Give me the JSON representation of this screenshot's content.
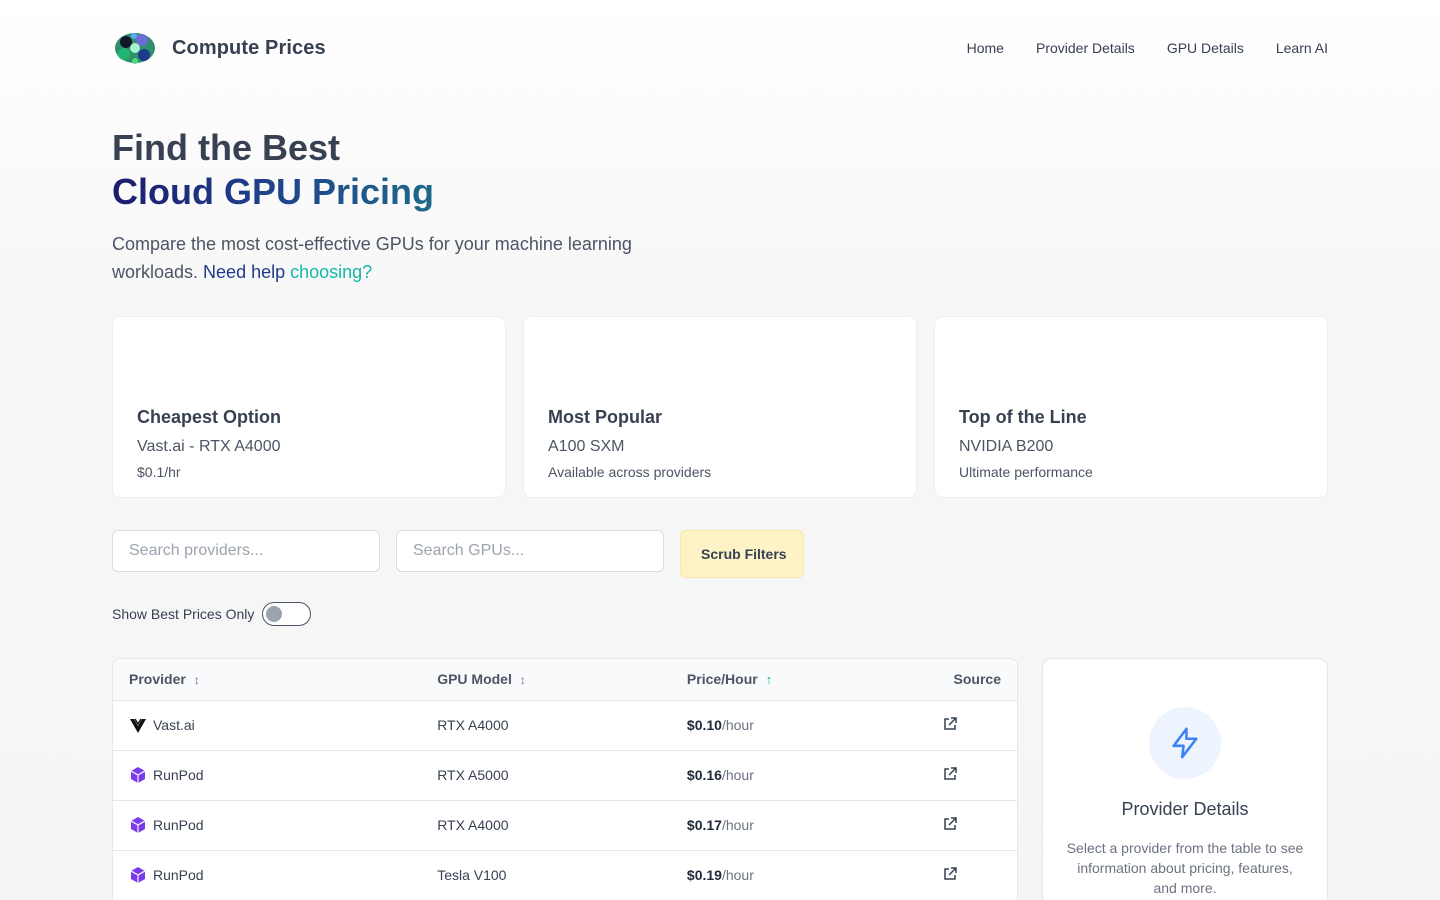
{
  "header": {
    "brand": "Compute Prices",
    "nav": [
      "Home",
      "Provider Details",
      "GPU Details",
      "Learn AI"
    ]
  },
  "hero": {
    "title_line1": "Find the Best",
    "title_line2": "Cloud GPU Pricing",
    "subtitle": "Compare the most cost-effective GPUs for your machine learning workloads. ",
    "help_part1": "Need help ",
    "help_part2": "choosing?"
  },
  "cards": [
    {
      "icon": "dollar-icon",
      "glyph": "",
      "title": "Cheapest Option",
      "main": "Vast.ai - RTX A4000",
      "sub": "$0.1/hr"
    },
    {
      "icon": "fire-icon",
      "glyph": "",
      "title": "Most Popular",
      "main": "A100 SXM",
      "sub": "Available across providers"
    },
    {
      "icon": "trophy-icon",
      "glyph": "",
      "title": "Top of the Line",
      "main": "NVIDIA B200",
      "sub": "Ultimate performance"
    }
  ],
  "filters": {
    "provider_placeholder": "Search providers...",
    "gpu_placeholder": "Search GPUs...",
    "scrub_glyph": "",
    "scrub_label": "Scrub Filters"
  },
  "toggle": {
    "label": "Show Best Prices Only",
    "checked": false
  },
  "table": {
    "headers": [
      "Provider",
      "GPU Model",
      "Price/Hour",
      "Source"
    ],
    "sort_glyph": "↕",
    "sort_active_glyph": "↑",
    "rows": [
      {
        "provider": "Vast.ai",
        "provider_icon": "vastai-logo-icon",
        "gpu": "RTX A4000",
        "price": "$0.10",
        "unit": "/hour"
      },
      {
        "provider": "RunPod",
        "provider_icon": "runpod-logo-icon",
        "gpu": "RTX A5000",
        "price": "$0.16",
        "unit": "/hour"
      },
      {
        "provider": "RunPod",
        "provider_icon": "runpod-logo-icon",
        "gpu": "RTX A4000",
        "price": "$0.17",
        "unit": "/hour"
      },
      {
        "provider": "RunPod",
        "provider_icon": "runpod-logo-icon",
        "gpu": "Tesla V100",
        "price": "$0.19",
        "unit": "/hour"
      }
    ]
  },
  "details_panel": {
    "icon": "lightning-icon",
    "title": "Provider Details",
    "text": "Select a provider from the table to see information about pricing, features, and more."
  },
  "colors": {
    "accent_teal": "#14b8a6",
    "accent_navy": "#1e3a8a",
    "scrub_bg": "#fef3c7",
    "bolt": "#3b82f6"
  }
}
